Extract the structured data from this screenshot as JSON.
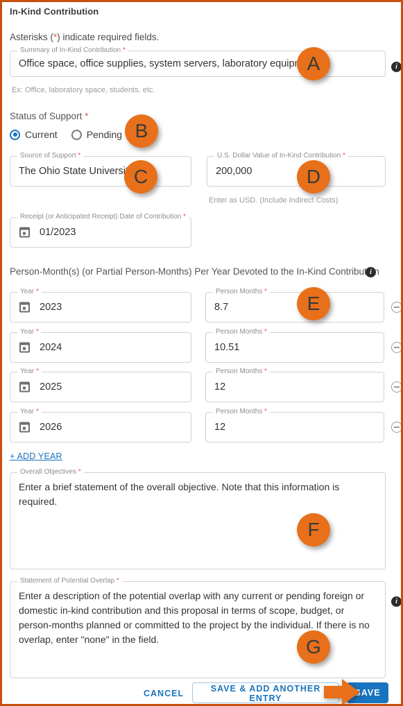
{
  "form": {
    "title": "In-Kind Contribution",
    "required_note_prefix": "Asterisks (",
    "required_note_asterisk": "*",
    "required_note_suffix": ") indicate required fields."
  },
  "summary_field": {
    "label": "Summary of In-Kind Contribution",
    "value": "Office space, office supplies, system servers, laboratory equipment",
    "helper": "Ex: Office, laboratory space, students, etc."
  },
  "status_of_support": {
    "label": "Status of Support",
    "options": [
      {
        "label": "Current",
        "selected": true
      },
      {
        "label": "Pending",
        "selected": false
      }
    ]
  },
  "source_of_support": {
    "label": "Source of Support",
    "value": "The Ohio State University"
  },
  "dollar_value": {
    "label": "U.S. Dollar Value of In-Kind Contribution",
    "value": "200,000",
    "helper": "Enter as USD. (Include Indirect Costs)"
  },
  "receipt_date": {
    "label": "Receipt (or Anticipated Receipt) Date of Contribution",
    "value": "01/2023"
  },
  "person_months_section": {
    "heading": "Person-Month(s) (or Partial Person-Months) Per Year Devoted to the In-Kind Contribution",
    "year_label": "Year",
    "months_label": "Person Months",
    "rows": [
      {
        "year": "2023",
        "months": "8.7"
      },
      {
        "year": "2024",
        "months": "10.51"
      },
      {
        "year": "2025",
        "months": "12"
      },
      {
        "year": "2026",
        "months": "12"
      }
    ],
    "add_year_label": "+ ADD YEAR"
  },
  "overall_objectives": {
    "label": "Overall Objectives",
    "value": "Enter a brief statement of the overall objective. Note that this information is required."
  },
  "statement_of_overlap": {
    "label": "Statement of Potential Overlap",
    "value": "Enter a description of the potential overlap with any current or pending foreign or domestic in-kind contribution and this proposal in terms of scope, budget, or person-months planned or committed to the project by the individual. If there is no overlap, enter \"none\" in the field."
  },
  "footer": {
    "cancel_label": "CANCEL",
    "save_add_another_label": "SAVE & ADD ANOTHER ENTRY",
    "save_label": "SAVE"
  },
  "annotations": {
    "a": "A",
    "b": "B",
    "c": "C",
    "d": "D",
    "e": "E",
    "f": "F",
    "g": "G"
  },
  "icons": {
    "info": "i"
  },
  "colors": {
    "frame_border": "#c8500f",
    "badge": "#e8701a",
    "accent_blue": "#1874bf",
    "required_red": "#e8564a"
  }
}
